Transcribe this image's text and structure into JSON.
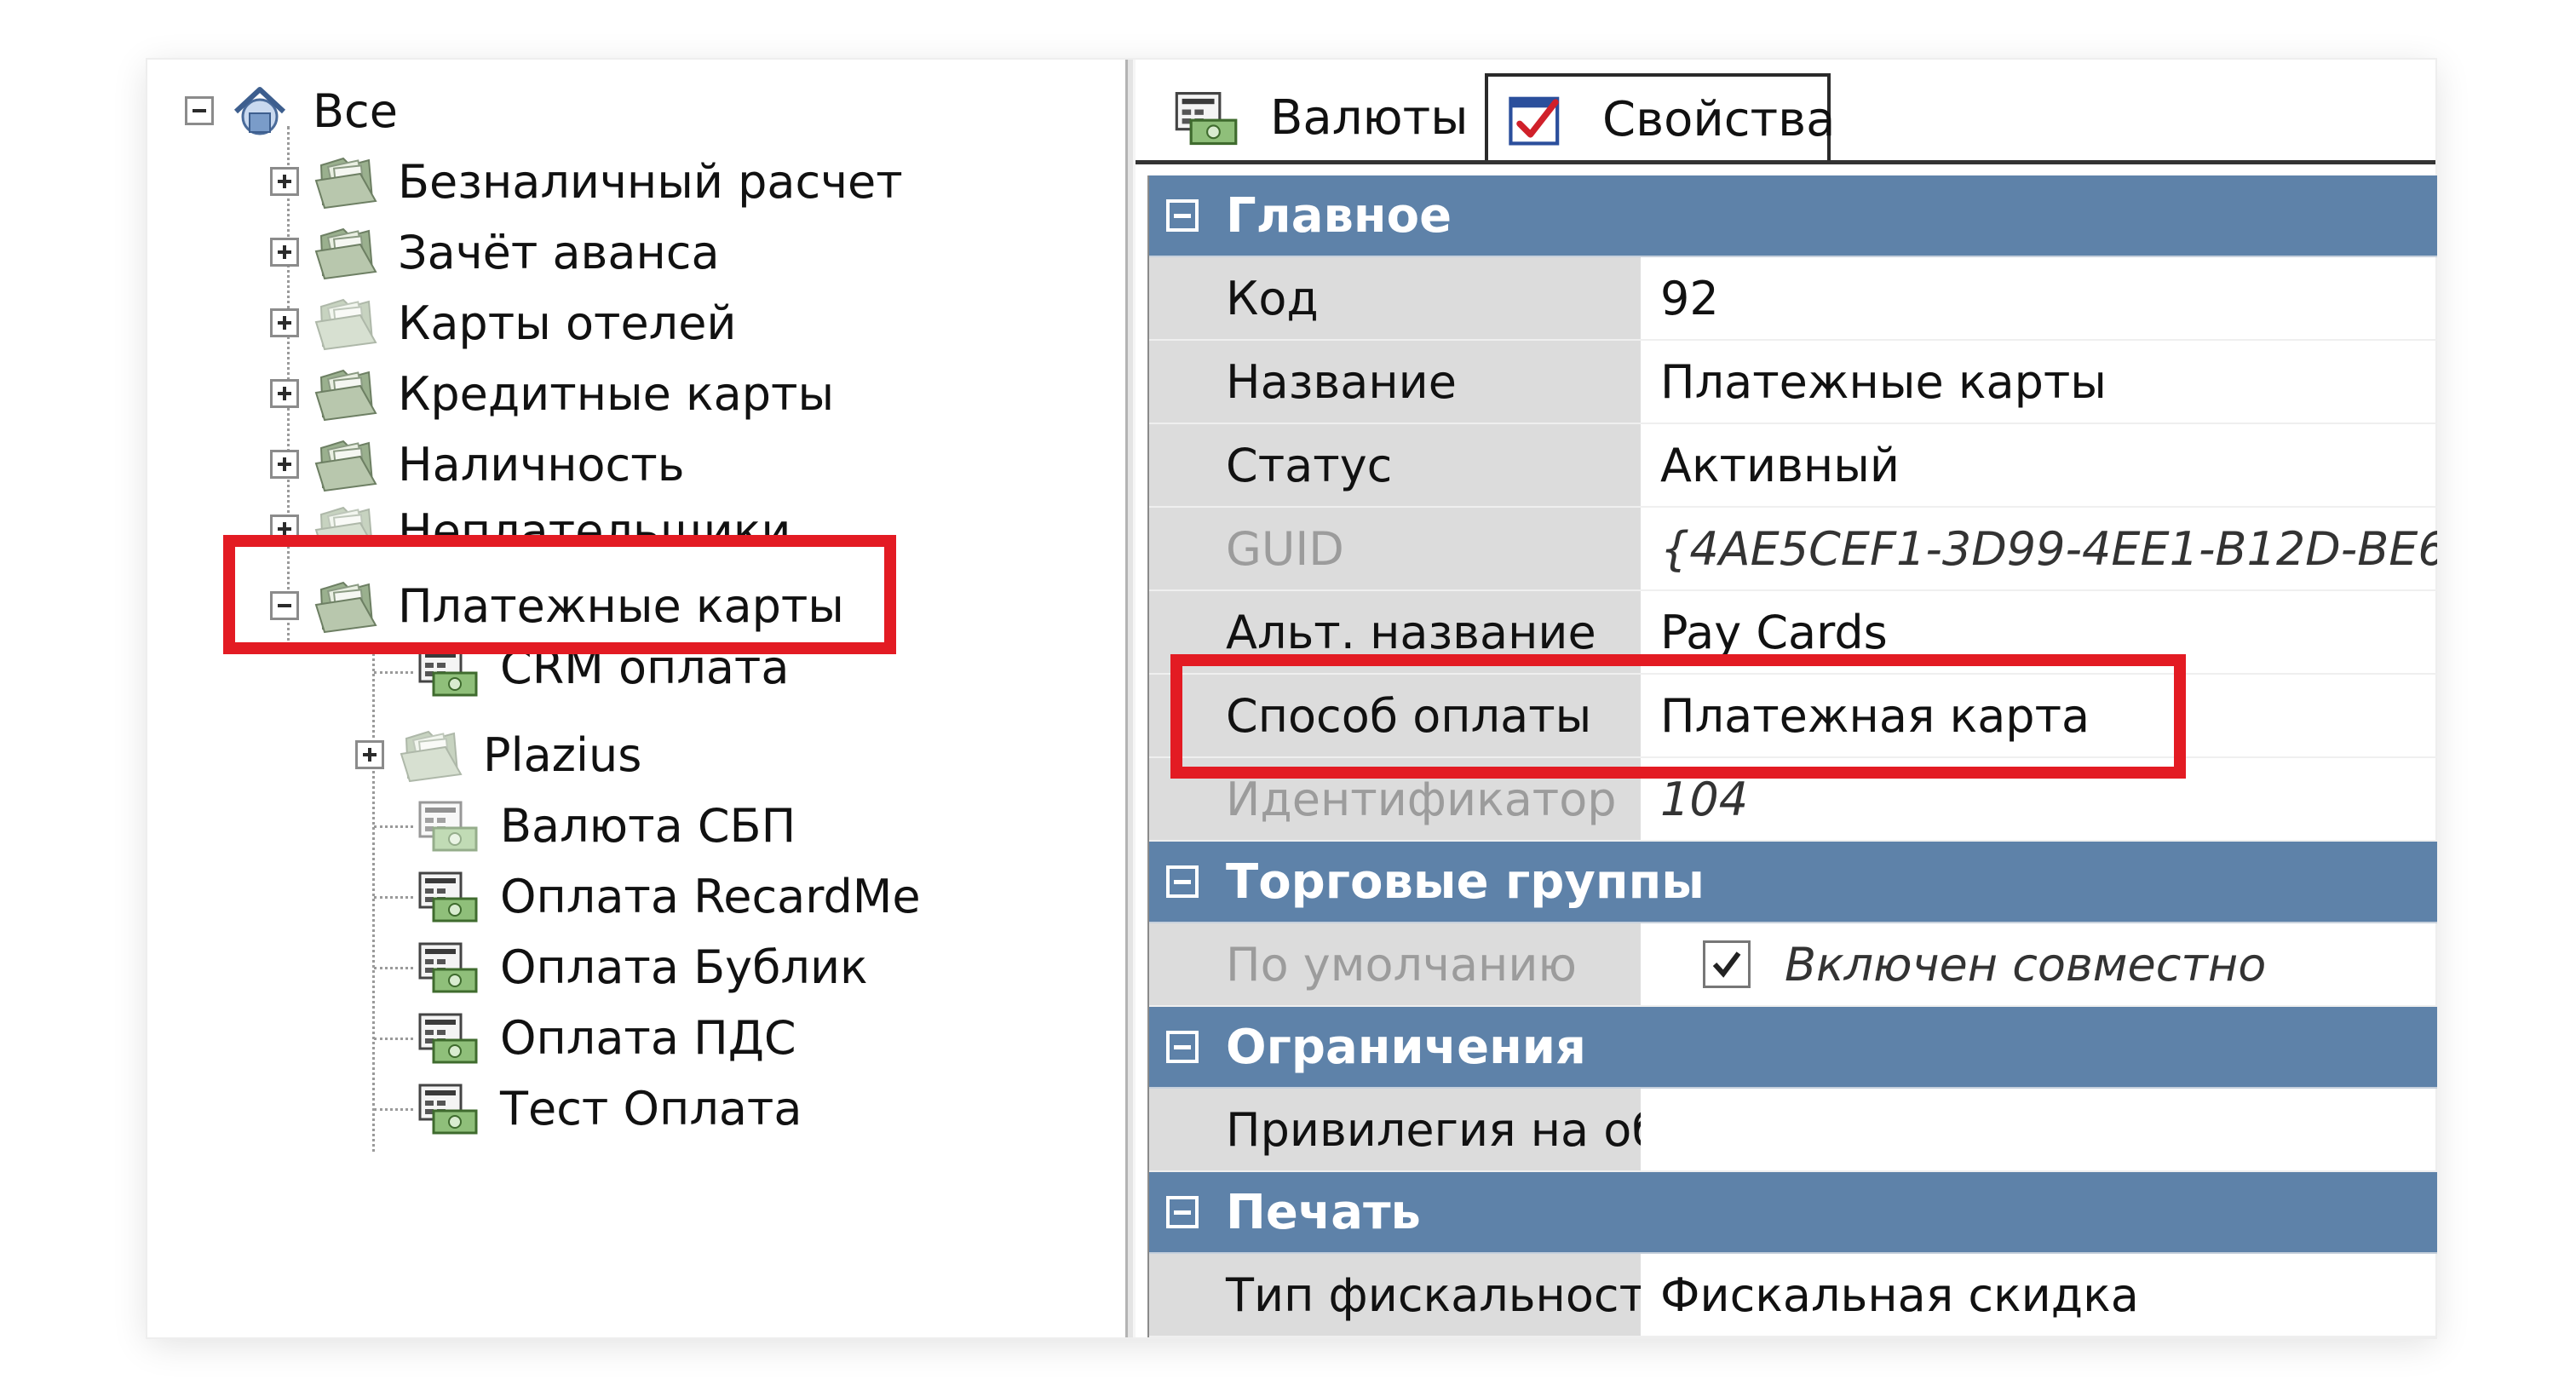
{
  "tree": {
    "root": {
      "label": "Все",
      "icon": "home-globe-icon"
    },
    "items": [
      {
        "label": "Безналичный расчет",
        "icon": "folder-money-icon",
        "expander": "plus"
      },
      {
        "label": "Зачёт аванса",
        "icon": "folder-money-icon",
        "expander": "plus"
      },
      {
        "label": "Карты отелей",
        "icon": "folder-money-icon",
        "expander": "plus"
      },
      {
        "label": "Кредитные карты",
        "icon": "folder-money-icon",
        "expander": "plus"
      },
      {
        "label": "Наличность",
        "icon": "folder-money-icon",
        "expander": "plus"
      },
      {
        "label": "Неплательщики",
        "icon": "folder-money-icon",
        "expander": "plus"
      },
      {
        "label": "Платежные карты",
        "icon": "folder-money-icon",
        "expander": "minus",
        "selected": true
      },
      {
        "label": "CRM оплата",
        "icon": "currency-icon"
      },
      {
        "label": "Plazius",
        "icon": "folder-money-icon",
        "expander": "plus"
      },
      {
        "label": "Валюта СБП",
        "icon": "currency-icon"
      },
      {
        "label": "Оплата RecardMe",
        "icon": "currency-icon"
      },
      {
        "label": "Оплата Бублик",
        "icon": "currency-icon"
      },
      {
        "label": "Оплата ПДС",
        "icon": "currency-icon"
      },
      {
        "label": "Тест Оплата",
        "icon": "currency-icon"
      }
    ]
  },
  "tabs": [
    {
      "label": "Валюты",
      "icon": "currency-list-icon",
      "active": false
    },
    {
      "label": "Свойства",
      "icon": "properties-check-icon",
      "active": true
    }
  ],
  "properties": {
    "main": {
      "title": "Главное",
      "rows": [
        {
          "name": "Код",
          "value": "92"
        },
        {
          "name": "Название",
          "value": "Платежные карты"
        },
        {
          "name": "Статус",
          "value": "Активный"
        },
        {
          "name": "GUID",
          "value": "{4AE5CEF1-3D99-4EE1-B12D-BE6"
        },
        {
          "name": "Альт. название",
          "value": "Pay Cards"
        },
        {
          "name": "Способ оплаты",
          "value": "Платежная карта"
        },
        {
          "name": "Идентификатор",
          "value": "104"
        }
      ]
    },
    "trade_groups": {
      "title": "Торговые группы",
      "rows": [
        {
          "name": "По умолчанию",
          "value": "Включен совместно",
          "checked": true
        }
      ]
    },
    "restrictions": {
      "title": "Ограничения",
      "rows": [
        {
          "name": "Привилегия на об",
          "value": ""
        }
      ]
    },
    "print": {
      "title": "Печать",
      "rows": [
        {
          "name": "Тип фискальност",
          "value": "Фискальная скидка"
        }
      ]
    }
  },
  "colors": {
    "section_header": "#5e82a9",
    "highlight": "#e31b23",
    "name_cell": "#dcdcdc"
  }
}
